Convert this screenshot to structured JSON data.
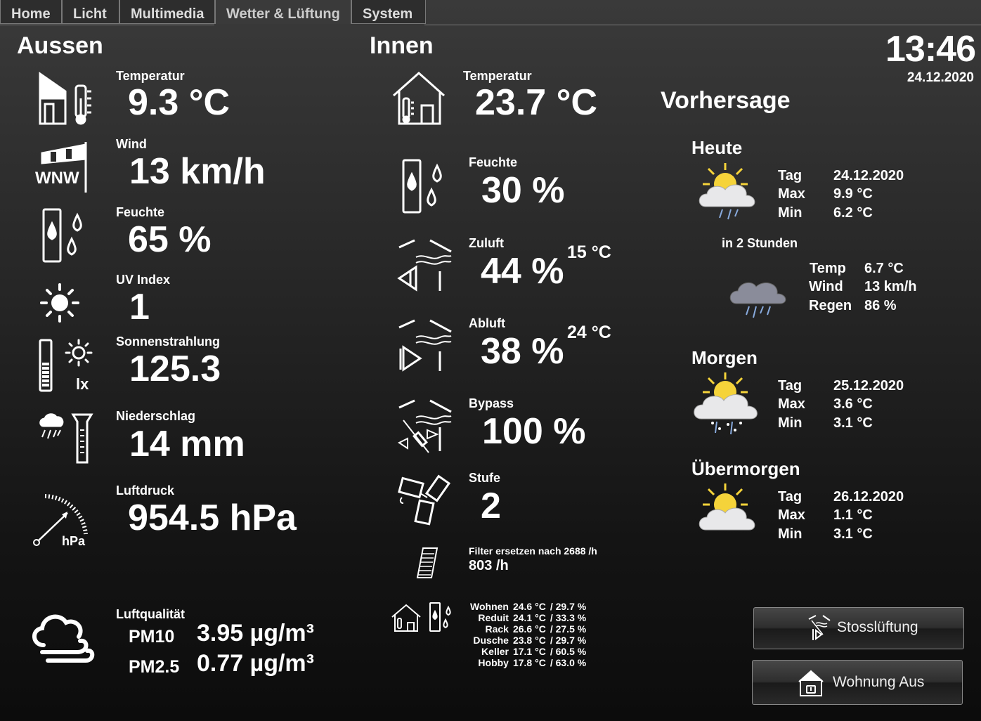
{
  "tabs": [
    "Home",
    "Licht",
    "Multimedia",
    "Wetter & Lüftung",
    "System"
  ],
  "clock": {
    "time": "13:46",
    "date": "24.12.2020"
  },
  "aussen": {
    "title": "Aussen",
    "temperatur": {
      "label": "Temperatur",
      "value": "9.3 °C"
    },
    "wind": {
      "label": "Wind",
      "value": "13 km/h",
      "direction": "WNW"
    },
    "feuchte": {
      "label": "Feuchte",
      "value": "65 %"
    },
    "uv": {
      "label": "UV Index",
      "value": "1"
    },
    "sonne": {
      "label": "Sonnenstrahlung",
      "value": "125.3",
      "unit": "lx"
    },
    "niederschlag": {
      "label": "Niederschlag",
      "value": "14 mm"
    },
    "luftdruck": {
      "label": "Luftdruck",
      "value": "954.5 hPa",
      "unit": "hPa"
    },
    "luftqualitaet": {
      "label": "Luftqualität",
      "pm10_label": "PM10",
      "pm10": "3.95 µg/m³",
      "pm25_label": "PM2.5",
      "pm25": "0.77 µg/m³"
    }
  },
  "innen": {
    "title": "Innen",
    "temperatur": {
      "label": "Temperatur",
      "value": "23.7 °C"
    },
    "feuchte": {
      "label": "Feuchte",
      "value": "30 %"
    },
    "zuluft": {
      "label": "Zuluft",
      "value": "44 %",
      "temp": "15 °C"
    },
    "abluft": {
      "label": "Abluft",
      "value": "38 %",
      "temp": "24 °C"
    },
    "bypass": {
      "label": "Bypass",
      "value": "100 %"
    },
    "stufe": {
      "label": "Stufe",
      "value": "2"
    },
    "filter": {
      "label": "Filter ersetzen nach 2688 /h",
      "value": "803 /h"
    },
    "rooms": [
      {
        "name": "Wohnen",
        "temp": "24.6 °C",
        "hum": "/ 29.7 %"
      },
      {
        "name": "Reduit",
        "temp": "24.1 °C",
        "hum": "/ 33.3 %"
      },
      {
        "name": "Rack",
        "temp": "26.6 °C",
        "hum": "/ 27.5 %"
      },
      {
        "name": "Dusche",
        "temp": "23.8 °C",
        "hum": "/ 29.7 %"
      },
      {
        "name": "Keller",
        "temp": "17.1 °C",
        "hum": "/ 60.5 %"
      },
      {
        "name": "Hobby",
        "temp": "17.8 °C",
        "hum": "/ 63.0 %"
      }
    ]
  },
  "vorhersage": {
    "title": "Vorhersage",
    "heute": {
      "title": "Heute",
      "tag_label": "Tag",
      "tag": "24.12.2020",
      "max_label": "Max",
      "max": "9.9 °C",
      "min_label": "Min",
      "min": "6.2 °C",
      "icon": "sun-cloud-rain-icon"
    },
    "in2": {
      "title": "in 2 Stunden",
      "temp_label": "Temp",
      "temp": "6.7 °C",
      "wind_label": "Wind",
      "wind": "13 km/h",
      "regen_label": "Regen",
      "regen": "86 %",
      "icon": "rain-cloud-icon"
    },
    "morgen": {
      "title": "Morgen",
      "tag_label": "Tag",
      "tag": "25.12.2020",
      "max_label": "Max",
      "max": "3.6 °C",
      "min_label": "Min",
      "min": "3.1 °C",
      "icon": "sun-cloud-snow-icon"
    },
    "uebermorgen": {
      "title": "Übermorgen",
      "tag_label": "Tag",
      "tag": "26.12.2020",
      "max_label": "Max",
      "max": "1.1 °C",
      "min_label": "Min",
      "min": "3.1 °C",
      "icon": "sun-cloud-icon"
    }
  },
  "buttons": {
    "stoss": "Stosslüftung",
    "wohnung": "Wohnung Aus"
  },
  "colors": {
    "accent_sun": "#f5d33a",
    "cloud": "#e8e8ea",
    "background_top": "#3a3a3a",
    "background_bottom": "#0c0c0c"
  }
}
